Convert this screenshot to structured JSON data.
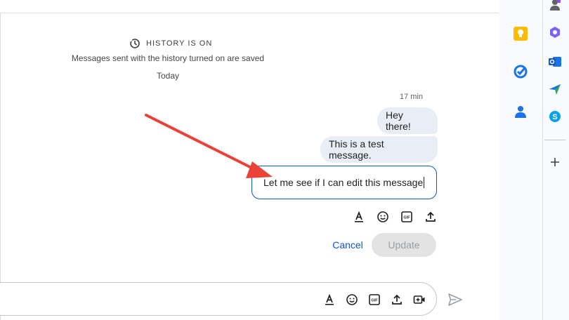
{
  "history": {
    "title": "HISTORY IS ON",
    "subtitle": "Messages sent with the history turned on are saved",
    "date_divider": "Today"
  },
  "messages": {
    "timestamp": "17 min",
    "items": [
      {
        "text": "Hey there!"
      },
      {
        "text": "This is a test message."
      }
    ]
  },
  "editor": {
    "value": "Let me see if I can edit this message",
    "cancel_label": "Cancel",
    "update_label": "Update"
  },
  "colors": {
    "accent": "#0b57d0",
    "bubble": "#e9eef6",
    "arrow": "#ea4335"
  },
  "side_apps": [
    "keep-icon",
    "tasks-icon",
    "contacts-icon"
  ],
  "far_apps": [
    "profile-icon",
    "copilot-icon",
    "outlook-icon",
    "send-app-icon",
    "skype-icon",
    "add-icon"
  ]
}
